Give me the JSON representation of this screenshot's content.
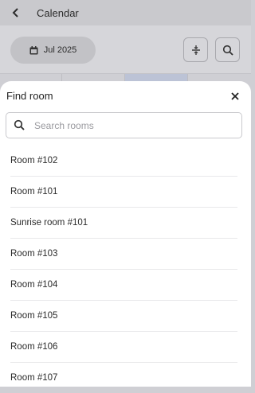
{
  "header": {
    "title": "Calendar"
  },
  "toolbar": {
    "month_label": "Jul 2025"
  },
  "dialog": {
    "title": "Find room",
    "search": {
      "placeholder": "Search rooms",
      "value": ""
    },
    "rooms": [
      "Room #102",
      "Room #101",
      "Sunrise room #101",
      "Room #103",
      "Room #104",
      "Room #105",
      "Room #106",
      "Room #107"
    ]
  },
  "icons": {
    "back": "chevron-left-icon",
    "calendar": "calendar-icon",
    "collapse": "collapse-vertical-icon",
    "search": "search-icon",
    "close": "close-icon"
  },
  "colors": {
    "accent_highlight": "#bcc3d6"
  }
}
